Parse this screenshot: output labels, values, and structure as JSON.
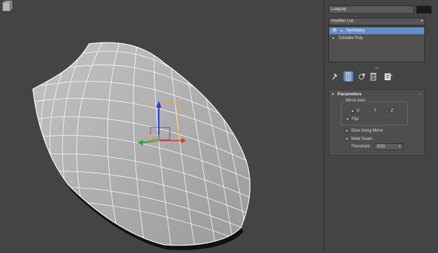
{
  "object_name": "Lowpoly",
  "modifier_list": {
    "label": "Modifier List",
    "arrow_icon": "dropdown-arrow-icon"
  },
  "stack": [
    {
      "label": "Symmetry",
      "selected": true,
      "eye": "👁",
      "arrow": "▸"
    },
    {
      "label": "Editable Poly",
      "selected": false,
      "arrow": "▸"
    }
  ],
  "toolbar": [
    "pin-stack-icon",
    "show-end-result-icon",
    "make-unique-icon",
    "remove-modifier-icon",
    "configure-modifier-sets-icon"
  ],
  "parameters": {
    "title": "Parameters",
    "collapse_arrow": "▾",
    "close": "×",
    "mirror_axis_label": "Mirror Axis:",
    "axes": [
      {
        "label": "X",
        "selected": true
      },
      {
        "label": "Y",
        "selected": false
      },
      {
        "label": "Z",
        "selected": false
      }
    ],
    "flip": {
      "label": "Flip",
      "checked": true
    },
    "slice_along_mirror": {
      "label": "Slice Along Mirror",
      "checked": true
    },
    "weld_seam": {
      "label": "Weld Seam",
      "checked": true
    },
    "threshold_label": "Threshold:",
    "threshold_value": "0.01",
    "spinner_arrows": "⇕"
  },
  "gizmo": {
    "x_color": "#d23a2a",
    "y_color": "#2fa33a",
    "z_color": "#2a3fd8",
    "pivot_color": "#e1a33a"
  }
}
